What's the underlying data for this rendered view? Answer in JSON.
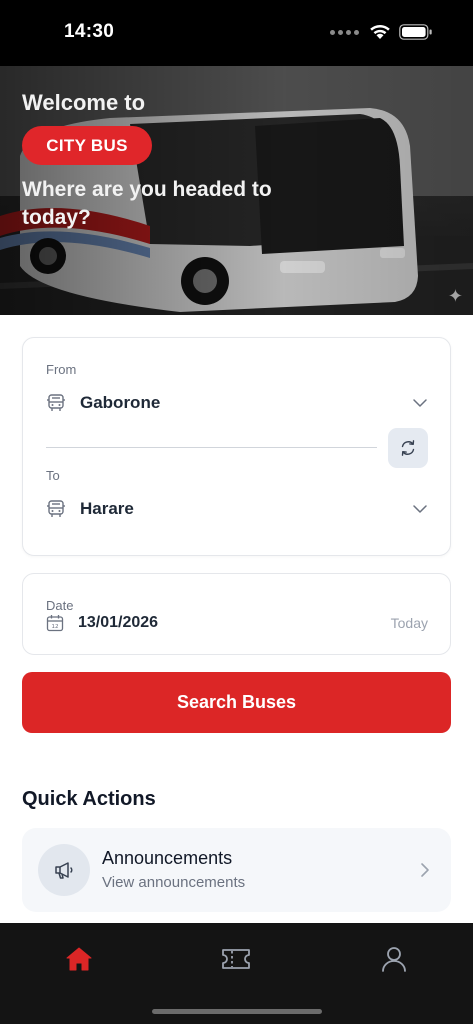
{
  "status_bar": {
    "time": "14:30"
  },
  "hero": {
    "welcome": "Welcome to",
    "brand": "CITY BUS",
    "question": "Where are you headed to today?"
  },
  "route": {
    "from_label": "From",
    "from_value": "Gaborone",
    "to_label": "To",
    "to_value": "Harare"
  },
  "date": {
    "label": "Date",
    "value": "13/01/2026",
    "relative": "Today"
  },
  "search_button": "Search Buses",
  "quick_actions": {
    "title": "Quick Actions",
    "items": [
      {
        "name": "Announcements",
        "subtitle": "View announcements",
        "icon": "megaphone-icon"
      }
    ]
  },
  "bottom_nav": {
    "items": [
      {
        "icon": "home-icon",
        "active": true
      },
      {
        "icon": "ticket-icon",
        "active": false
      },
      {
        "icon": "profile-icon",
        "active": false
      }
    ]
  },
  "colors": {
    "brand_red": "#dc2626",
    "badge_red": "#e0262a",
    "nav_background": "#141414"
  }
}
